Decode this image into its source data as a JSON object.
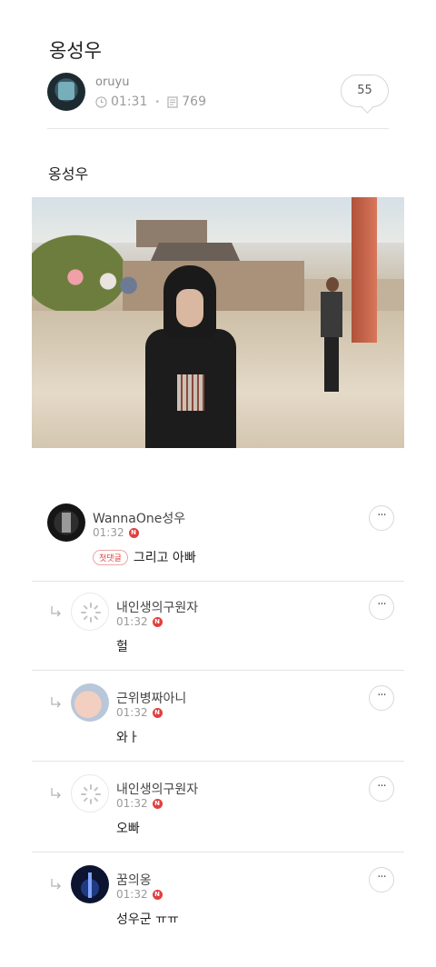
{
  "post": {
    "title": "옹성우",
    "author": "oruyu",
    "time": "01:31",
    "views": "769",
    "comment_count": "55",
    "body_text": "옹성우"
  },
  "icons": {
    "clock": "clock-icon",
    "views": "document-icon",
    "more": "more-icon",
    "reply": "reply-arrow-icon",
    "new_badge": "N"
  },
  "colors": {
    "accent": "#e0403e"
  },
  "comments": [
    {
      "name": "WannaOne성우",
      "time": "01:32",
      "new": "N",
      "first_badge": "첫댓글",
      "text": "그리고 아빠",
      "more": "···"
    },
    {
      "name": "내인생의구원자",
      "time": "01:32",
      "new": "N",
      "text": "헐",
      "more": "···"
    },
    {
      "name": "근위병짜아니",
      "time": "01:32",
      "new": "N",
      "text": "와ㅏ",
      "more": "···"
    },
    {
      "name": "내인생의구원자",
      "time": "01:32",
      "new": "N",
      "text": "오빠",
      "more": "···"
    },
    {
      "name": "꿈의옹",
      "time": "01:32",
      "new": "N",
      "text": "성우군 ㅠㅠ",
      "more": "···"
    }
  ]
}
